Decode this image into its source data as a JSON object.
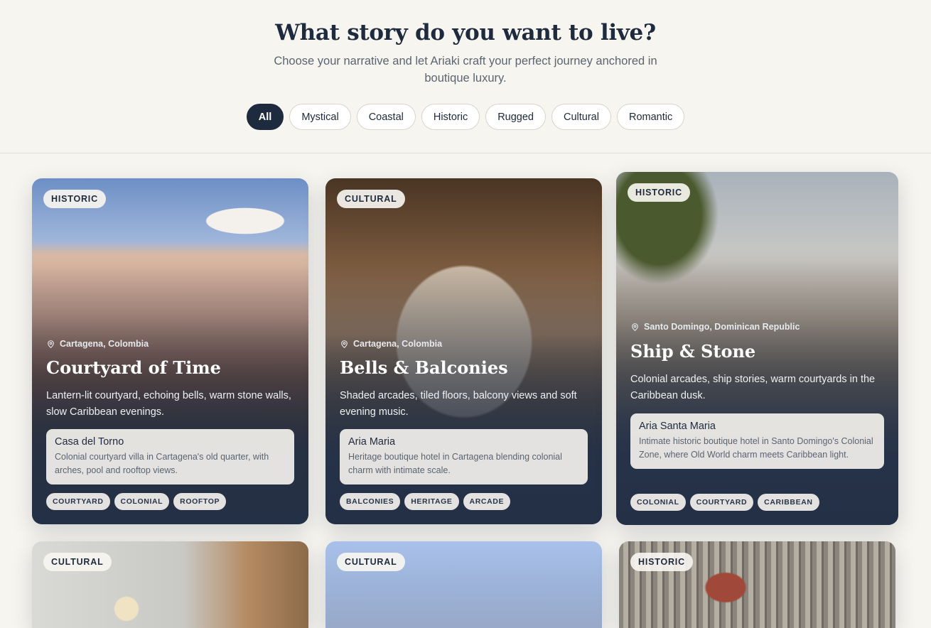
{
  "header": {
    "title": "What story do you want to live?",
    "subtitle": "Choose your narrative and let Ariaki craft your perfect journey anchored in boutique luxury."
  },
  "filters": [
    "All",
    "Mystical",
    "Coastal",
    "Historic",
    "Rugged",
    "Cultural",
    "Romantic"
  ],
  "active_filter": "All",
  "cards": [
    {
      "badge": "HISTORIC",
      "location": "Cartagena, Colombia",
      "title": "Courtyard of Time",
      "description": "Lantern-lit courtyard, echoing bells, warm stone walls, slow Caribbean evenings.",
      "hotel_name": "Casa del Torno",
      "hotel_description": "Colonial courtyard villa in Cartagena's old quarter, with arches, pool and rooftop views.",
      "tags": [
        "COURTYARD",
        "COLONIAL",
        "ROOFTOP"
      ]
    },
    {
      "badge": "CULTURAL",
      "location": "Cartagena, Colombia",
      "title": "Bells & Balconies",
      "description": "Shaded arcades, tiled floors, balcony views and soft evening music.",
      "hotel_name": "Aria Maria",
      "hotel_description": "Heritage boutique hotel in Cartagena blending colonial charm with intimate scale.",
      "tags": [
        "BALCONIES",
        "HERITAGE",
        "ARCADE"
      ]
    },
    {
      "badge": "HISTORIC",
      "location": "Santo Domingo, Dominican Republic",
      "title": "Ship & Stone",
      "description": "Colonial arcades, ship stories, warm courtyards in the Caribbean dusk.",
      "hotel_name": "Aria Santa Maria",
      "hotel_description": "Intimate historic boutique hotel in Santo Domingo's Colonial Zone, where Old World charm meets Caribbean light.",
      "tags": [
        "COLONIAL",
        "COURTYARD",
        "CARIBBEAN"
      ]
    },
    {
      "badge": "CULTURAL"
    },
    {
      "badge": "CULTURAL"
    },
    {
      "badge": "HISTORIC"
    }
  ],
  "colors": {
    "background": "#f7f5f0",
    "navy": "#1e2a3d",
    "chip_border": "#d9d5cc"
  },
  "icons": {
    "location": "map-pin-icon"
  }
}
